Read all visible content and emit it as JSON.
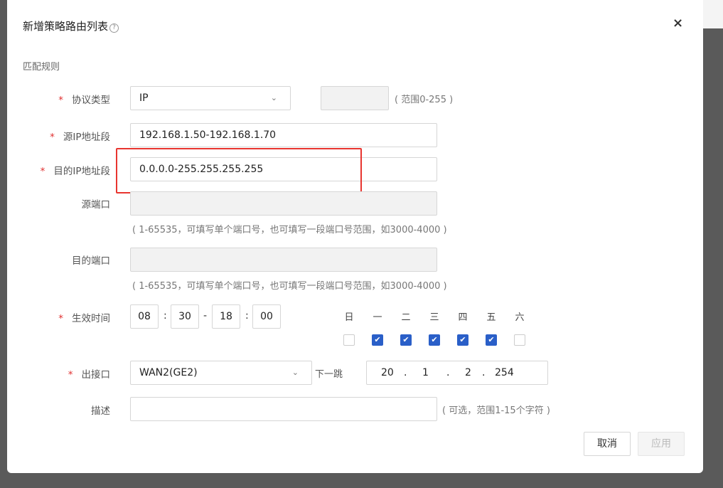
{
  "dialog": {
    "title": "新增策略路由列表",
    "close_label": "×",
    "section": "匹配规则"
  },
  "protocol": {
    "label": "协议类型",
    "value": "IP",
    "number_value": "",
    "hint": "( 范围0-255 )"
  },
  "src_ip": {
    "label": "源IP地址段",
    "value": "192.168.1.50-192.168.1.70"
  },
  "dst_ip": {
    "label": "目的IP地址段",
    "value": "0.0.0.0-255.255.255.255"
  },
  "src_port": {
    "label": "源端口",
    "value": "",
    "hint": "( 1-65535，可填写单个端口号，也可填写一段端口号范围，如3000-4000 )"
  },
  "dst_port": {
    "label": "目的端口",
    "value": "",
    "hint": "( 1-65535，可填写单个端口号，也可填写一段端口号范围，如3000-4000 )"
  },
  "time": {
    "label": "生效时间",
    "start_h": "08",
    "start_m": "30",
    "end_h": "18",
    "end_m": "00",
    "colon": ":",
    "dash": "-",
    "days": [
      {
        "label": "日",
        "checked": false
      },
      {
        "label": "一",
        "checked": true
      },
      {
        "label": "二",
        "checked": true
      },
      {
        "label": "三",
        "checked": true
      },
      {
        "label": "四",
        "checked": true
      },
      {
        "label": "五",
        "checked": true
      },
      {
        "label": "六",
        "checked": false
      }
    ]
  },
  "iface": {
    "label": "出接口",
    "value": "WAN2(GE2)",
    "nexthop_label": "下一跳",
    "nexthop": [
      "20",
      "1",
      "2",
      "254"
    ]
  },
  "desc": {
    "label": "描述",
    "value": "",
    "hint": "( 可选，范围1-15个字符 )"
  },
  "buttons": {
    "cancel": "取消",
    "apply": "应用"
  },
  "colors": {
    "accent": "#2a5fc8",
    "required": "#e03030",
    "highlight": "#e8352f"
  }
}
